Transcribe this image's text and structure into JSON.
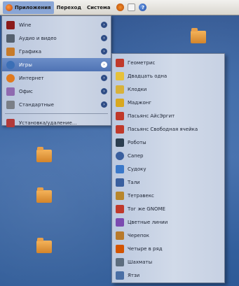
{
  "panel": {
    "menus": [
      {
        "label": "Приложения"
      },
      {
        "label": "Переход"
      },
      {
        "label": "Система"
      }
    ],
    "tray_icons": [
      "firefox-icon",
      "notes-icon",
      "help-icon"
    ],
    "help_glyph": "?"
  },
  "applications_menu": {
    "items": [
      {
        "label": "Wine",
        "icon": "wine-icon",
        "color": "#8b1a1a"
      },
      {
        "label": "Аудио и видео",
        "icon": "audio-video-icon",
        "color": "#55606e"
      },
      {
        "label": "Графика",
        "icon": "graphics-icon",
        "color": "#c77b2a"
      },
      {
        "label": "Игры",
        "icon": "games-icon",
        "color": "#3b6fb6"
      },
      {
        "label": "Интернет",
        "icon": "internet-icon",
        "color": "#e07a1f"
      },
      {
        "label": "Офис",
        "icon": "office-icon",
        "color": "#8f6ab0"
      },
      {
        "label": "Стандартные",
        "icon": "accessories-icon",
        "color": "#7a7f87"
      }
    ],
    "footer_item": {
      "label": "Установка/удаление...",
      "icon": "install-remove-icon",
      "color": "#b23a3a"
    },
    "submenu_arrow": "›"
  },
  "games_submenu": {
    "items": [
      {
        "label": "Геометрис",
        "color": "#c0392b"
      },
      {
        "label": "Двадцать одна",
        "color": "#e6c13a"
      },
      {
        "label": "Клодки",
        "color": "#d8b23a"
      },
      {
        "label": "Маджонг",
        "color": "#d9a820"
      },
      {
        "label": "Пасьянс АйсЭргит",
        "color": "#c0392b"
      },
      {
        "label": "Пасьянс Свободная ячейка",
        "color": "#c0392b"
      },
      {
        "label": "Роботы",
        "color": "#2c3e50"
      },
      {
        "label": "Сапер",
        "color": "#3a5f9e"
      },
      {
        "label": "Судоку",
        "color": "#3a78c9"
      },
      {
        "label": "Тали",
        "color": "#3a5f9e"
      },
      {
        "label": "Тетравекс",
        "color": "#b8862c"
      },
      {
        "label": "Тог же GNOME",
        "color": "#c0392b"
      },
      {
        "label": "Цветные линии",
        "color": "#7b4ab0"
      },
      {
        "label": "Черепок",
        "color": "#b87a2c"
      },
      {
        "label": "Четыре в ряд",
        "color": "#d35400"
      },
      {
        "label": "Шахматы",
        "color": "#5d6d7e"
      },
      {
        "label": "Ятзи",
        "color": "#4a6fa5"
      }
    ]
  },
  "desktop": {
    "icons": [
      {
        "label": "",
        "icon": "folder-icon"
      },
      {
        "label": "",
        "icon": "folder-icon"
      },
      {
        "label": "",
        "icon": "folder-icon"
      },
      {
        "label": "",
        "icon": "folder-icon"
      }
    ]
  }
}
